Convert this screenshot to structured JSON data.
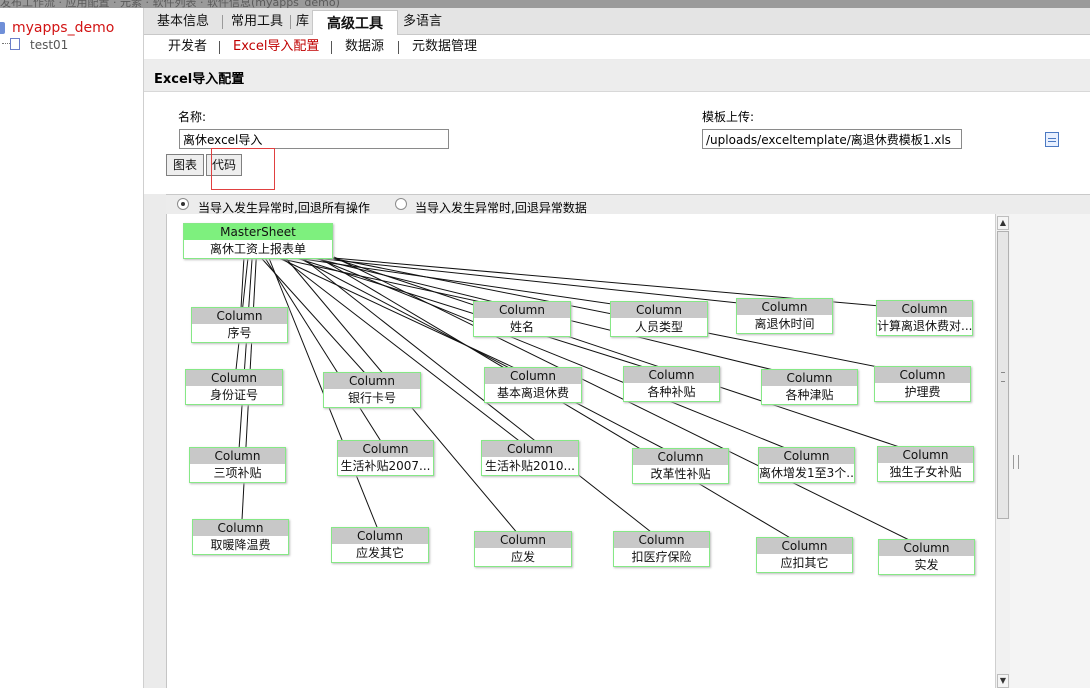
{
  "topbar": {
    "text": "发布工作流 · 应用配置 · 元素 · 软件列表 · 软件信息(myapps_demo)"
  },
  "tree": {
    "root_label": "myapps_demo",
    "children": [
      "test01"
    ]
  },
  "tabs": [
    {
      "label": "基本信息"
    },
    {
      "label": "常用工具"
    },
    {
      "label": "库"
    },
    {
      "label": "高级工具",
      "active": true
    },
    {
      "label": "多语言"
    }
  ],
  "subtabs": [
    {
      "label": "开发者"
    },
    {
      "label": "Excel导入配置",
      "active": true
    },
    {
      "label": "数据源"
    },
    {
      "label": "元数据管理"
    }
  ],
  "section_title": "Excel导入配置",
  "form": {
    "name_label": "名称:",
    "name_value": "离休excel导入",
    "template_label": "模板上传:",
    "template_value": "/uploads/exceltemplate/离退休费模板1.xls"
  },
  "view_buttons": {
    "chart": "图表",
    "code": "代码"
  },
  "options": {
    "rollback_all": "当导入发生异常时,回退所有操作",
    "rollback_errors": "当导入发生异常时,回退异常数据",
    "selected": "rollback_all"
  },
  "colors": {
    "accent_red": "#c00000",
    "master_header": "#7ef07e",
    "node_border": "#86e886",
    "column_header": "#c8c8c8"
  },
  "diagram": {
    "master": {
      "head": "MasterSheet",
      "body": "离休工资上报表单"
    },
    "columns": [
      {
        "head": "Column",
        "body": "序号"
      },
      {
        "head": "Column",
        "body": "身份证号"
      },
      {
        "head": "Column",
        "body": "三项补贴"
      },
      {
        "head": "Column",
        "body": "取暖降温费"
      },
      {
        "head": "Column",
        "body": "银行卡号"
      },
      {
        "head": "Column",
        "body": "生活补贴2007..."
      },
      {
        "head": "Column",
        "body": "应发其它"
      },
      {
        "head": "Column",
        "body": "姓名"
      },
      {
        "head": "Column",
        "body": "基本离退休费"
      },
      {
        "head": "Column",
        "body": "生活补贴2010..."
      },
      {
        "head": "Column",
        "body": "应发"
      },
      {
        "head": "Column",
        "body": "人员类型"
      },
      {
        "head": "Column",
        "body": "各种补贴"
      },
      {
        "head": "Column",
        "body": "改革性补贴"
      },
      {
        "head": "Column",
        "body": "扣医疗保险"
      },
      {
        "head": "Column",
        "body": "离退休时间"
      },
      {
        "head": "Column",
        "body": "各种津贴"
      },
      {
        "head": "Column",
        "body": "离休增发1至3个..."
      },
      {
        "head": "Column",
        "body": "应扣其它"
      },
      {
        "head": "Column",
        "body": "计算离退休费对..."
      },
      {
        "head": "Column",
        "body": "护理费"
      },
      {
        "head": "Column",
        "body": "独生子女补贴"
      },
      {
        "head": "Column",
        "body": "实发"
      }
    ]
  }
}
